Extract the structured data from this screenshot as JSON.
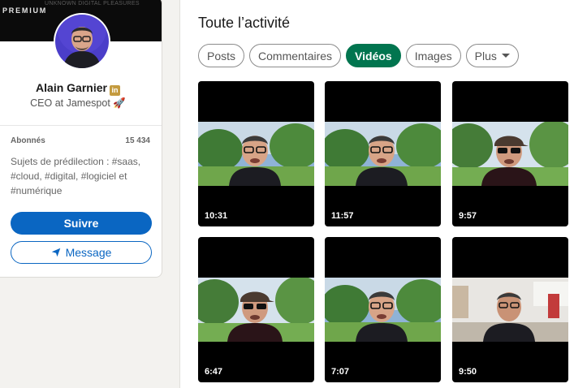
{
  "profile": {
    "badge": "PREMIUM",
    "banner_caption": "UNKNOWN DIGITAL PLEASURES",
    "name": "Alain Garnier",
    "premium_icon_letters": "in",
    "headline": "CEO at Jamespot 🚀",
    "followers_label": "Abonnés",
    "followers_count": "15 434",
    "topics": "Sujets de prédilection : #saas, #cloud, #digital, #logiciel et #numérique",
    "follow_label": "Suivre",
    "message_label": "Message",
    "colors": {
      "primary": "#0a66c2",
      "premium_gold": "#c49b3f"
    }
  },
  "activity": {
    "title": "Toute l’activité",
    "filters": [
      {
        "label": "Posts",
        "active": false
      },
      {
        "label": "Commentaires",
        "active": false
      },
      {
        "label": "Vidéos",
        "active": true
      },
      {
        "label": "Images",
        "active": false
      },
      {
        "label": "Plus",
        "active": false,
        "dropdown": true
      }
    ],
    "active_color": "#01754f",
    "videos": [
      {
        "duration": "10:31",
        "scene": "garden"
      },
      {
        "duration": "11:57",
        "scene": "garden"
      },
      {
        "duration": "9:57",
        "scene": "garden-cap"
      },
      {
        "duration": "6:47",
        "scene": "garden-cap"
      },
      {
        "duration": "7:07",
        "scene": "garden"
      },
      {
        "duration": "9:50",
        "scene": "office"
      }
    ]
  }
}
